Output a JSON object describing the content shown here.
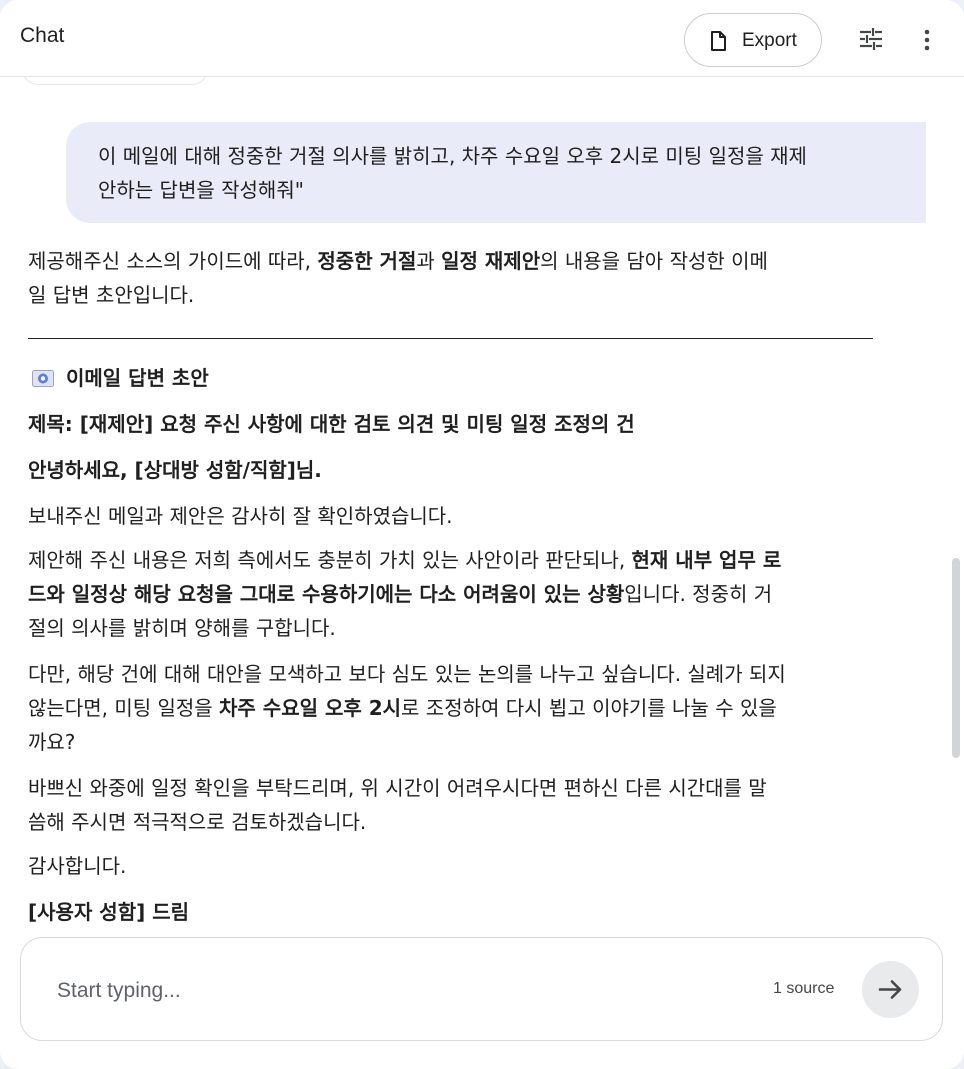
{
  "header": {
    "title": "Chat",
    "export_label": "Export"
  },
  "conversation": {
    "user_message_line1": "이 메일에 대해 정중한 거절 의사를 밝히고, 차주 수요일 오후 2시로 미팅 일정을 재제",
    "user_message_line2": "안하는 답변을 작성해줘\"",
    "intro": {
      "part1": "제공해주신 소스의 가이드에 따라, ",
      "bold1": "정중한 거절",
      "part2": "과 ",
      "bold2": "일정 재제안",
      "part3": "의 내용을 담아 작성한 이메",
      "line2": "일 답변 초안입니다."
    },
    "draft_heading": "이메일 답변 초안",
    "subject": "제목: [재제안] 요청 주신 사항에 대한 검토 의견 및 미팅 일정 조정의 건",
    "greeting": "안녕하세요, [상대방 성함/직함]님.",
    "p1": "보내주신 메일과 제안은 감사히 잘 확인하였습니다.",
    "p2": {
      "line1_plain": "제안해 주신 내용은 저희 측에서도 충분히 가치 있는 사안이라 판단되나, ",
      "line1_bold": "현재 내부 업무 로",
      "line2_bold": "드와 일정상 해당 요청을 그대로 수용하기에는 다소 어려움이 있는 상황",
      "line2_plain": "입니다. 정중히 거",
      "line3": "절의 의사를 밝히며 양해를 구합니다."
    },
    "p3": {
      "line1": "다만, 해당 건에 대해 대안을 모색하고 보다 심도 있는 논의를 나누고 싶습니다. 실례가 되지",
      "line2_plain1": "않는다면, 미팅 일정을 ",
      "line2_bold": "차주 수요일 오후 2시",
      "line2_plain2": "로 조정하여 다시 뵙고 이야기를 나눌 수 있을",
      "line3": "까요?"
    },
    "p4": {
      "line1": "바쁘신 와중에 일정 확인을 부탁드리며, 위 시간이 어려우시다면 편하신 다른 시간대를 말",
      "line2": "씀해 주시면 적극적으로 검토하겠습니다."
    },
    "closing": "감사합니다.",
    "signature": "[사용자 성함] 드림"
  },
  "composer": {
    "placeholder": "Start typing...",
    "source_count": "1 source"
  },
  "icons": {
    "export": "document-icon",
    "tune": "tune-icon",
    "more": "more-vert-icon",
    "email": "email-icon",
    "send": "arrow-right-icon"
  }
}
